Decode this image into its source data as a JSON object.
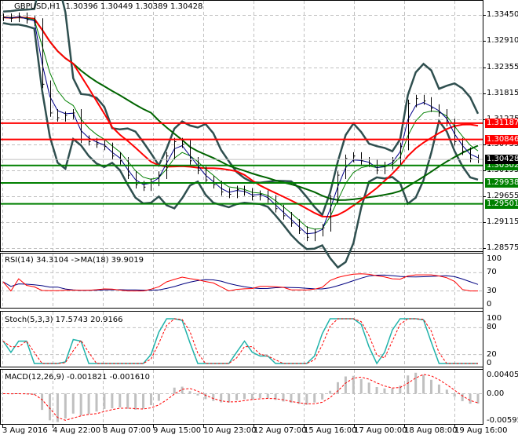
{
  "window": {
    "symbol_label": "GBPUSD,H1",
    "ohlc_label": "1.30396 1.30449 1.30389 1.30428"
  },
  "chart_data": [
    {
      "type": "line",
      "title": "GBPUSD,H1",
      "style": "hlc-bars",
      "subtitle": "1.30396 1.30449 1.30389 1.30428",
      "close": [
        1.334,
        1.3338,
        1.3342,
        1.3335,
        1.333,
        1.32,
        1.314,
        1.313,
        1.3135,
        1.314,
        1.3085,
        1.308,
        1.3075,
        1.307,
        1.305,
        1.304,
        1.301,
        1.299,
        1.2985,
        1.2995,
        1.301,
        1.305,
        1.308,
        1.3075,
        1.304,
        1.302,
        1.3,
        1.299,
        1.2975,
        1.297,
        1.298,
        1.2975,
        1.2965,
        1.297,
        1.296,
        1.294,
        1.2925,
        1.291,
        1.2895,
        1.288,
        1.289,
        1.29,
        1.296,
        1.301,
        1.3045,
        1.305,
        1.304,
        1.3035,
        1.302,
        1.303,
        1.304,
        1.307,
        1.316,
        1.317,
        1.3165,
        1.315,
        1.314,
        1.312,
        1.308,
        1.306,
        1.3045,
        1.3043
      ],
      "ylim": [
        1.28575,
        1.3345
      ],
      "y_ticks": [
        "1.33450",
        "1.32910",
        "1.32355",
        "1.31815",
        "1.31275",
        "1.30735",
        "1.30195",
        "1.29655",
        "1.29115",
        "1.28575"
      ],
      "x_ticks": [
        "3 Aug 2016",
        "4 Aug 22:00",
        "8 Aug 07:00",
        "9 Aug 15:00",
        "10 Aug 23:00",
        "12 Aug 07:00",
        "15 Aug 16:00",
        "17 Aug 00:00",
        "18 Aug 08:00",
        "19 Aug 16:00"
      ],
      "grid": true,
      "current_price": {
        "value": 1.30428,
        "label": "1.30428",
        "color": "#000000"
      },
      "levels": [
        {
          "value": 1.31187,
          "label": "1.31187",
          "color": "#ff0000"
        },
        {
          "value": 1.30846,
          "label": "1.30846",
          "color": "#ff0000"
        },
        {
          "value": 1.30302,
          "label": "1.30302",
          "color": "#008000"
        },
        {
          "value": 1.29938,
          "label": "1.29938",
          "color": "#008000"
        },
        {
          "value": 1.29501,
          "label": "1.29501",
          "color": "#008000"
        }
      ],
      "overlays": {
        "bollinger_color": "#2f4f4f",
        "ma_fast_color": "#00008b",
        "ma_mid_color": "#008000",
        "ma_red_color": "#ff0000",
        "ma_slow_color": "#006400"
      }
    },
    {
      "type": "line",
      "title": "RSI(14) 34.3104  ->MA(18) 39.9019",
      "ylim": [
        0,
        100
      ],
      "y_ticks": [
        "100",
        "70",
        "30",
        "0"
      ],
      "series_colors": {
        "rsi": "#ff0000",
        "ma": "#000080"
      }
    },
    {
      "type": "line",
      "title": "Stoch(5,3,3) 17.5743 20.9166",
      "ylim": [
        0,
        100
      ],
      "y_ticks": [
        "100",
        "80",
        "20",
        "0"
      ],
      "series_colors": {
        "main": "#20b2aa",
        "signal": "#ff0000"
      }
    },
    {
      "type": "bar",
      "title": "MACD(12,26,9) -0.001821 -0.001610",
      "ylim": [
        -0.005951,
        0.004055
      ],
      "y_ticks": [
        "0.004055",
        "0.00",
        "-0.005951"
      ],
      "series_colors": {
        "histogram": "#c0c0c0",
        "signal": "#ff0000"
      }
    }
  ]
}
